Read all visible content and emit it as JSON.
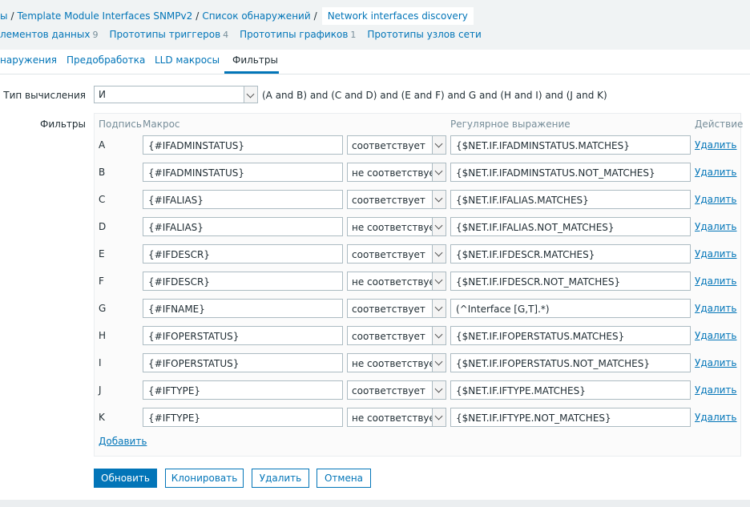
{
  "breadcrumb": {
    "items": [
      {
        "label": "ы"
      },
      {
        "label": "Template Module Interfaces SNMPv2"
      },
      {
        "label": "Список обнаружений"
      },
      {
        "label": "Network interfaces discovery"
      }
    ],
    "separator": "/"
  },
  "subnav": [
    {
      "label": "лементов данных",
      "count": "9"
    },
    {
      "label": "Прототипы триггеров",
      "count": "4"
    },
    {
      "label": "Прототипы графиков",
      "count": "1"
    },
    {
      "label": "Прототипы узлов сети",
      "count": ""
    }
  ],
  "tabs": [
    {
      "label": "наружения"
    },
    {
      "label": "Предобработка"
    },
    {
      "label": "LLD макросы"
    },
    {
      "label": "Фильтры",
      "active": true
    }
  ],
  "form": {
    "calc_label": "Тип вычисления",
    "calc_value": "И",
    "formula": "(A and B) and (C and D) and (E and F) and G and (H and I) and (J and K)",
    "filters_label": "Фильтры"
  },
  "filters": {
    "headers": {
      "label": "Подпись",
      "macro": "Макрос",
      "regex": "Регулярное выражение",
      "action": "Действие"
    },
    "rows": [
      {
        "letter": "A",
        "macro": "{#IFADMINSTATUS}",
        "op": "соответствует",
        "regex": "{$NET.IF.IFADMINSTATUS.MATCHES}",
        "action": "Удалить"
      },
      {
        "letter": "B",
        "macro": "{#IFADMINSTATUS}",
        "op": "не соответствует",
        "regex": "{$NET.IF.IFADMINSTATUS.NOT_MATCHES}",
        "action": "Удалить"
      },
      {
        "letter": "C",
        "macro": "{#IFALIAS}",
        "op": "соответствует",
        "regex": "{$NET.IF.IFALIAS.MATCHES}",
        "action": "Удалить"
      },
      {
        "letter": "D",
        "macro": "{#IFALIAS}",
        "op": "не соответствует",
        "regex": "{$NET.IF.IFALIAS.NOT_MATCHES}",
        "action": "Удалить"
      },
      {
        "letter": "E",
        "macro": "{#IFDESCR}",
        "op": "соответствует",
        "regex": "{$NET.IF.IFDESCR.MATCHES}",
        "action": "Удалить"
      },
      {
        "letter": "F",
        "macro": "{#IFDESCR}",
        "op": "не соответствует",
        "regex": "{$NET.IF.IFDESCR.NOT_MATCHES}",
        "action": "Удалить"
      },
      {
        "letter": "G",
        "macro": "{#IFNAME}",
        "op": "соответствует",
        "regex": "(^Interface [G,T].*)",
        "action": "Удалить"
      },
      {
        "letter": "H",
        "macro": "{#IFOPERSTATUS}",
        "op": "соответствует",
        "regex": "{$NET.IF.IFOPERSTATUS.MATCHES}",
        "action": "Удалить"
      },
      {
        "letter": "I",
        "macro": "{#IFOPERSTATUS}",
        "op": "не соответствует",
        "regex": "{$NET.IF.IFOPERSTATUS.NOT_MATCHES}",
        "action": "Удалить"
      },
      {
        "letter": "J",
        "macro": "{#IFTYPE}",
        "op": "соответствует",
        "regex": "{$NET.IF.IFTYPE.MATCHES}",
        "action": "Удалить"
      },
      {
        "letter": "K",
        "macro": "{#IFTYPE}",
        "op": "не соответствует",
        "regex": "{$NET.IF.IFTYPE.NOT_MATCHES}",
        "action": "Удалить"
      }
    ],
    "add_label": "Добавить"
  },
  "buttons": {
    "update": "Обновить",
    "clone": "Клонировать",
    "delete": "Удалить",
    "cancel": "Отмена"
  },
  "colors": {
    "accent": "#0275b8",
    "text": "#1f2c33",
    "muted": "#768d99",
    "header_bg": "#f0f3f4"
  }
}
